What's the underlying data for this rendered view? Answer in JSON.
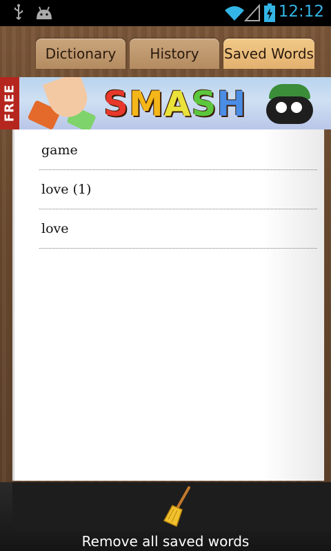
{
  "status_bar": {
    "time": "12:12",
    "icons": [
      "usb-icon",
      "android-debug-icon",
      "wifi-icon",
      "signal-icon",
      "battery-charging-icon"
    ]
  },
  "tabs": [
    {
      "label": "Dictionary",
      "active": false
    },
    {
      "label": "History",
      "active": false
    },
    {
      "label": "Saved Words",
      "active": true
    }
  ],
  "banner": {
    "free_label": "FREE",
    "title": "SMASH"
  },
  "saved_words": [
    {
      "word": "game"
    },
    {
      "word": "love (1)"
    },
    {
      "word": "love"
    }
  ],
  "footer": {
    "action_label": "Remove all saved words",
    "icon": "broom-icon"
  },
  "colors": {
    "clock": "#33b5e5",
    "active_tab": "#e3b170",
    "inactive_tab": "#b48c62"
  }
}
